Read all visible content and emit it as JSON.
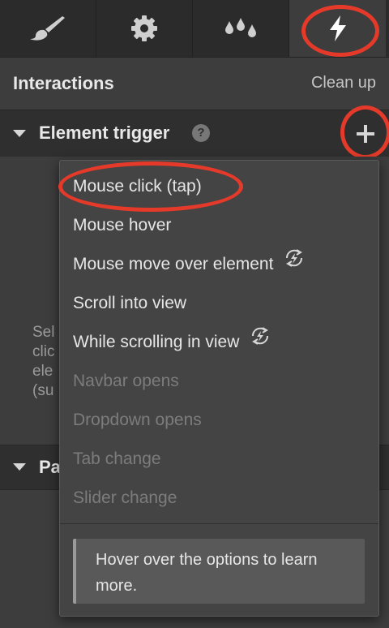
{
  "tabs": [
    {
      "icon": "brush-icon"
    },
    {
      "icon": "gear-icon"
    },
    {
      "icon": "drops-icon"
    },
    {
      "icon": "lightning-icon"
    }
  ],
  "panel": {
    "title": "Interactions",
    "clean_up": "Clean up"
  },
  "section": {
    "title": "Element trigger",
    "help": "?"
  },
  "background_text": [
    "Sel",
    "clic",
    "ele",
    "(su"
  ],
  "section2": {
    "title": "Pa"
  },
  "menu": {
    "items": [
      {
        "label": "Mouse click (tap)",
        "disabled": false,
        "continuous": false
      },
      {
        "label": "Mouse hover",
        "disabled": false,
        "continuous": false
      },
      {
        "label": "Mouse move over element",
        "disabled": false,
        "continuous": true
      },
      {
        "label": "Scroll into view",
        "disabled": false,
        "continuous": false
      },
      {
        "label": "While scrolling in view",
        "disabled": false,
        "continuous": true
      },
      {
        "label": "Navbar opens",
        "disabled": true,
        "continuous": false
      },
      {
        "label": "Dropdown opens",
        "disabled": true,
        "continuous": false
      },
      {
        "label": "Tab change",
        "disabled": true,
        "continuous": false
      },
      {
        "label": "Slider change",
        "disabled": true,
        "continuous": false
      }
    ],
    "hint": "Hover over the options to learn more."
  },
  "colors": {
    "annotation": "#e53a2a",
    "panel": "#3d3d3d",
    "menu": "#444444"
  }
}
